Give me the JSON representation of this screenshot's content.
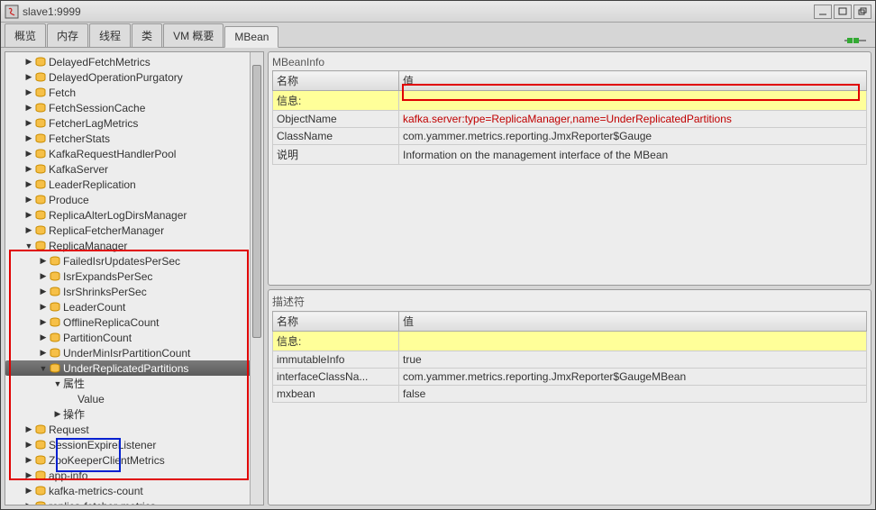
{
  "window_title": "slave1:9999",
  "tabs": [
    "概览",
    "内存",
    "线程",
    "类",
    "VM 概要",
    "MBean"
  ],
  "active_tab": "MBean",
  "tree": {
    "l1": [
      "DelayedFetchMetrics",
      "DelayedOperationPurgatory",
      "Fetch",
      "FetchSessionCache",
      "FetcherLagMetrics",
      "FetcherStats",
      "KafkaRequestHandlerPool",
      "KafkaServer",
      "LeaderReplication",
      "Produce",
      "ReplicaAlterLogDirsManager",
      "ReplicaFetcherManager",
      "ReplicaManager",
      "Request",
      "SessionExpireListener",
      "ZooKeeperClientMetrics",
      "app-info",
      "kafka-metrics-count",
      "replica-fetcher-metrics"
    ],
    "replicaManagerChildren": [
      "FailedIsrUpdatesPerSec",
      "IsrExpandsPerSec",
      "IsrShrinksPerSec",
      "LeaderCount",
      "OfflineReplicaCount",
      "PartitionCount",
      "UnderMinIsrPartitionCount",
      "UnderReplicatedPartitions"
    ],
    "selected": "UnderReplicatedPartitions",
    "underRepl": {
      "attr": "属性",
      "value": "Value",
      "ops": "操作"
    }
  },
  "mbeanInfo": {
    "title": "MBeanInfo",
    "headers": [
      "名称",
      "值"
    ],
    "info_label": "信息:",
    "rows": [
      {
        "name": "ObjectName",
        "value": "kafka.server:type=ReplicaManager,name=UnderReplicatedPartitions",
        "red": true
      },
      {
        "name": "ClassName",
        "value": "com.yammer.metrics.reporting.JmxReporter$Gauge",
        "red": false
      },
      {
        "name": "说明",
        "value": "Information on the management interface of the MBean",
        "red": false
      }
    ]
  },
  "descriptor": {
    "title": "描述符",
    "headers": [
      "名称",
      "值"
    ],
    "info_label": "信息:",
    "rows": [
      {
        "name": "immutableInfo",
        "value": "true"
      },
      {
        "name": "interfaceClassNa...",
        "value": "com.yammer.metrics.reporting.JmxReporter$GaugeMBean"
      },
      {
        "name": "mxbean",
        "value": "false"
      }
    ]
  }
}
